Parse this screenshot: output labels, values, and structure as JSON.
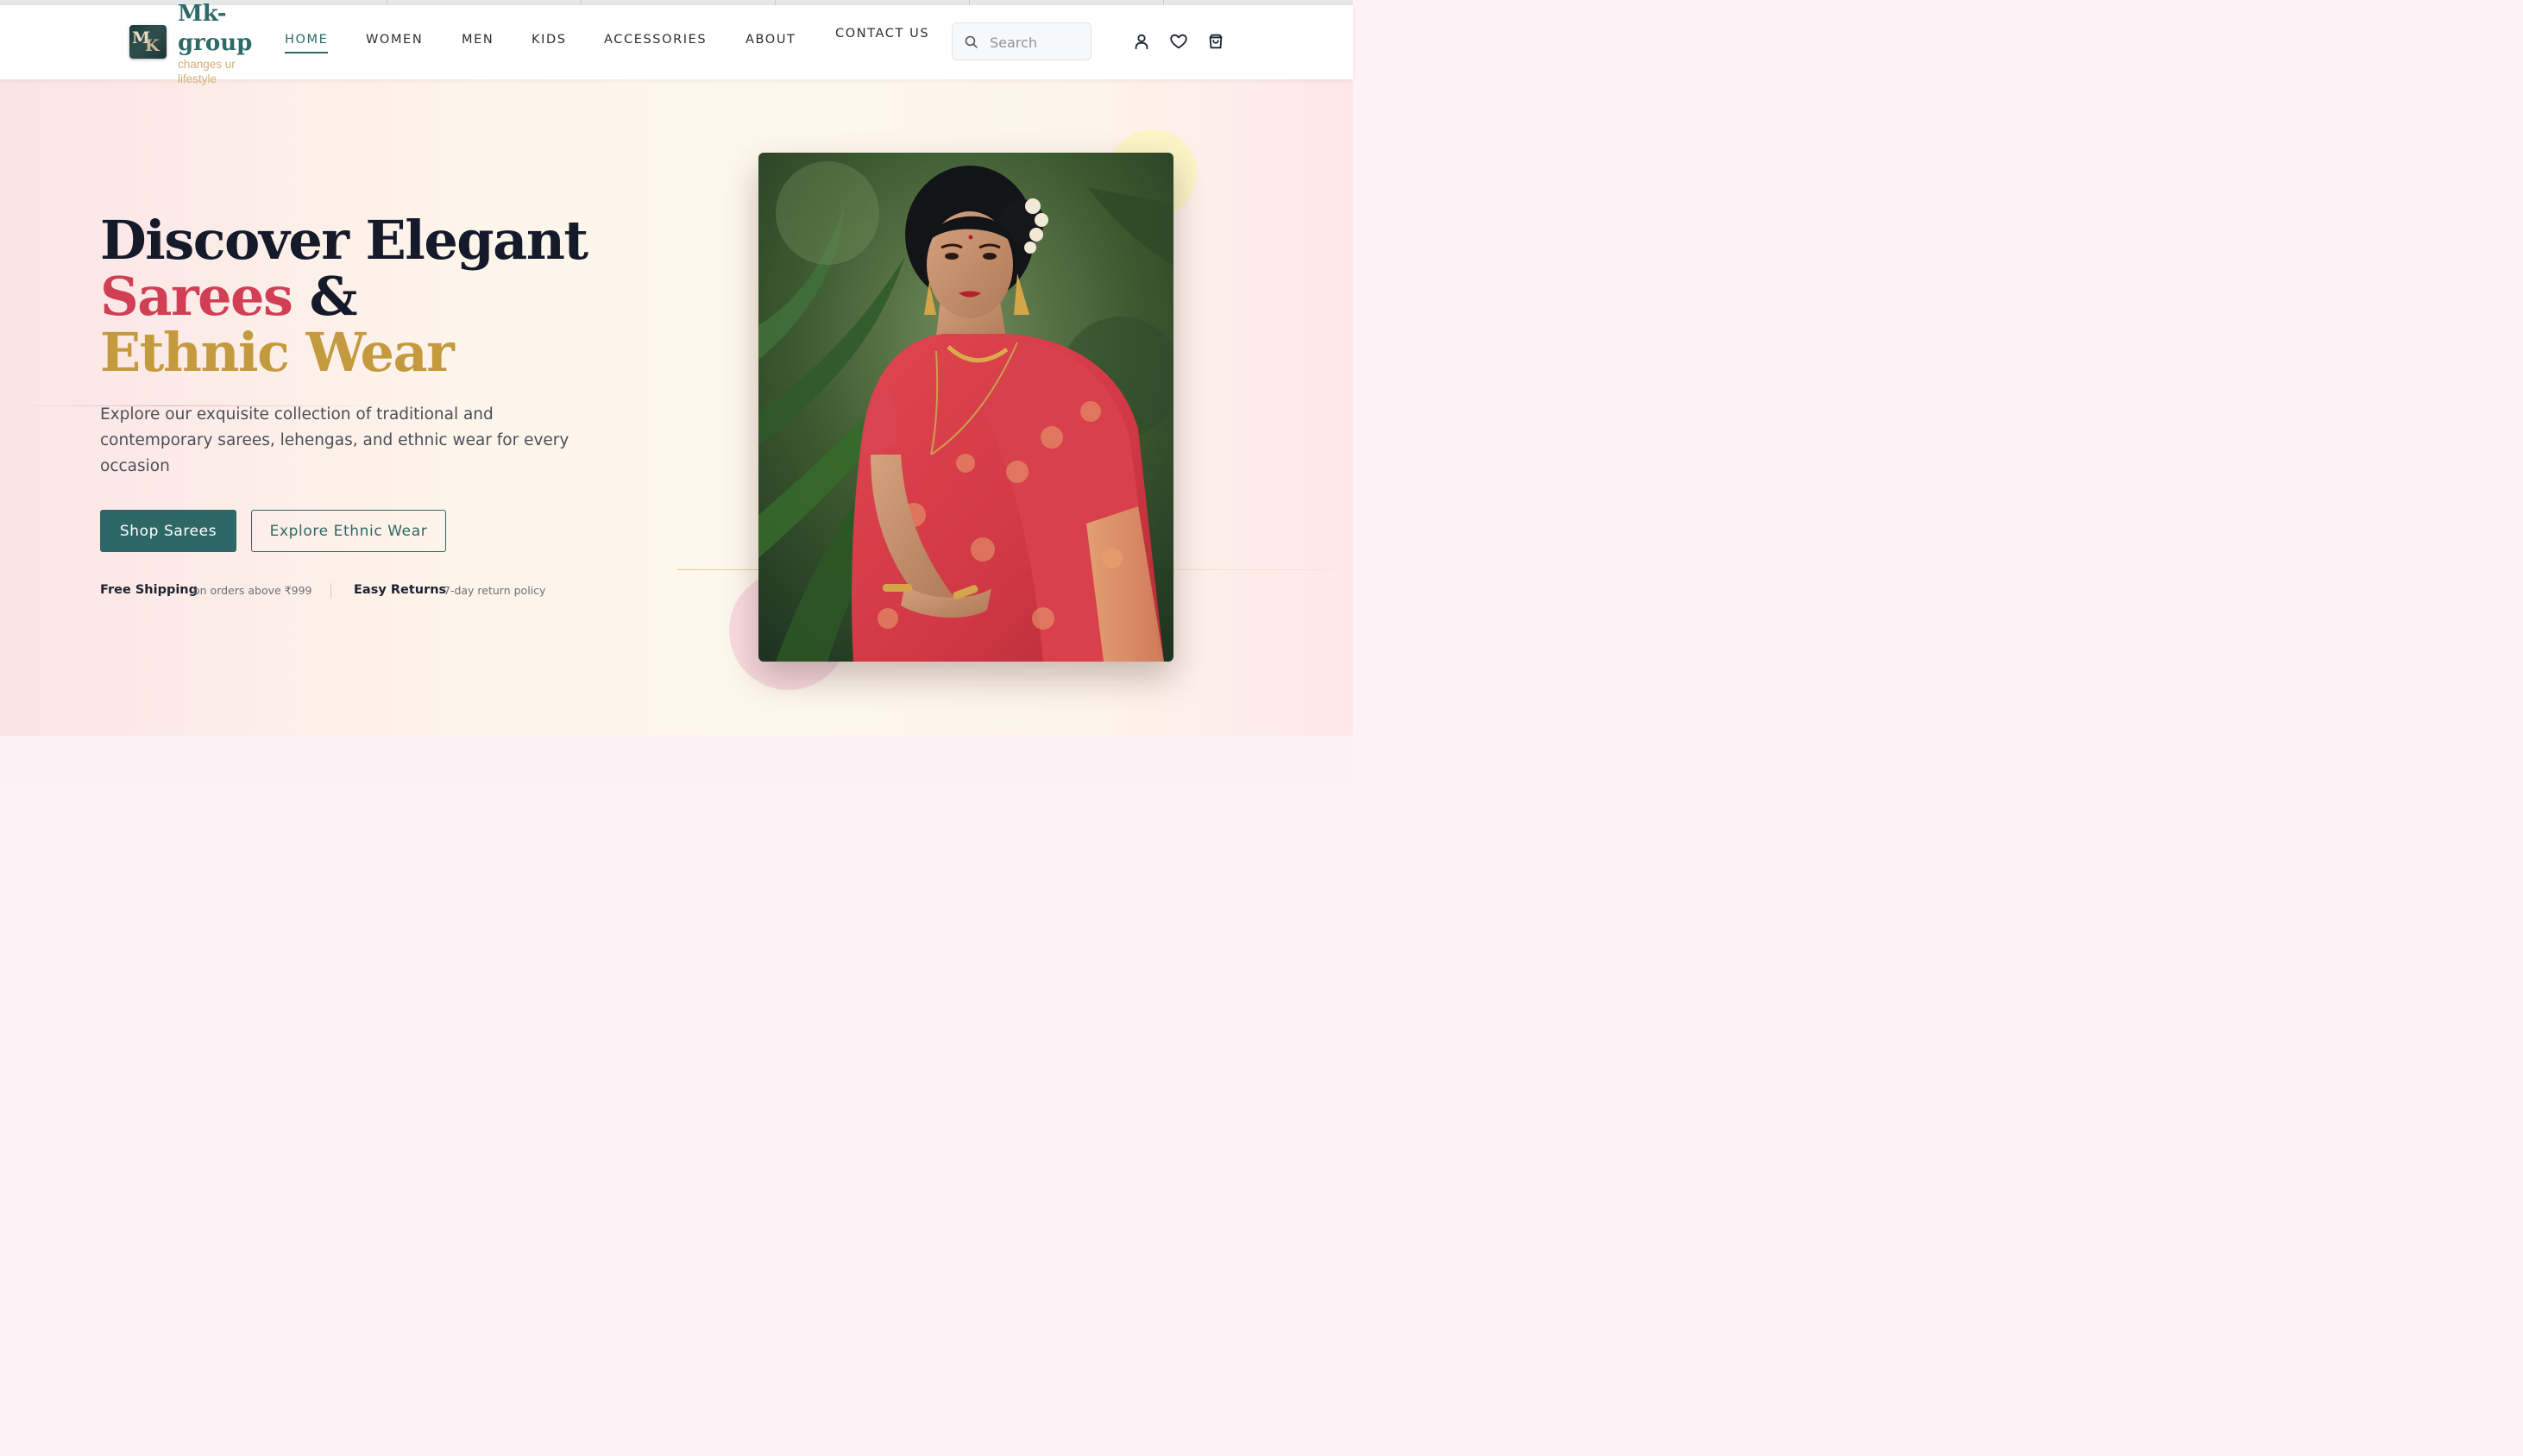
{
  "brand": {
    "name": "Mk-group",
    "tagline": "changes ur lifestyle",
    "logo_letters": "MK"
  },
  "nav": {
    "items": [
      {
        "label": "HOME",
        "active": true
      },
      {
        "label": "WOMEN",
        "active": false
      },
      {
        "label": "MEN",
        "active": false
      },
      {
        "label": "KIDS",
        "active": false
      },
      {
        "label": "ACCESSORIES",
        "active": false
      },
      {
        "label": "ABOUT",
        "active": false
      }
    ],
    "contact": "CONTACT US"
  },
  "search": {
    "placeholder": "Search",
    "value": ""
  },
  "header_icons": [
    "user-icon",
    "heart-icon",
    "shopping-bag-icon"
  ],
  "hero": {
    "headline_line1": "Discover Elegant",
    "headline_sarees": "Sarees",
    "headline_amp": "&",
    "headline_line3": "Ethnic Wear",
    "subtext": "Explore our exquisite collection of traditional and contemporary sarees, lehengas, and ethnic wear for every occasion",
    "primary_cta": "Shop Sarees",
    "secondary_cta": "Explore Ethnic Wear",
    "perks": [
      {
        "title": "Free Shipping",
        "desc": "on orders above ₹999"
      },
      {
        "title": "Easy Returns",
        "desc": "7-day return policy"
      }
    ]
  },
  "colors": {
    "accent_teal": "#2d6866",
    "saree_red": "#d13f55",
    "gold": "#c49a3e",
    "heading_dark": "#141a2a"
  }
}
